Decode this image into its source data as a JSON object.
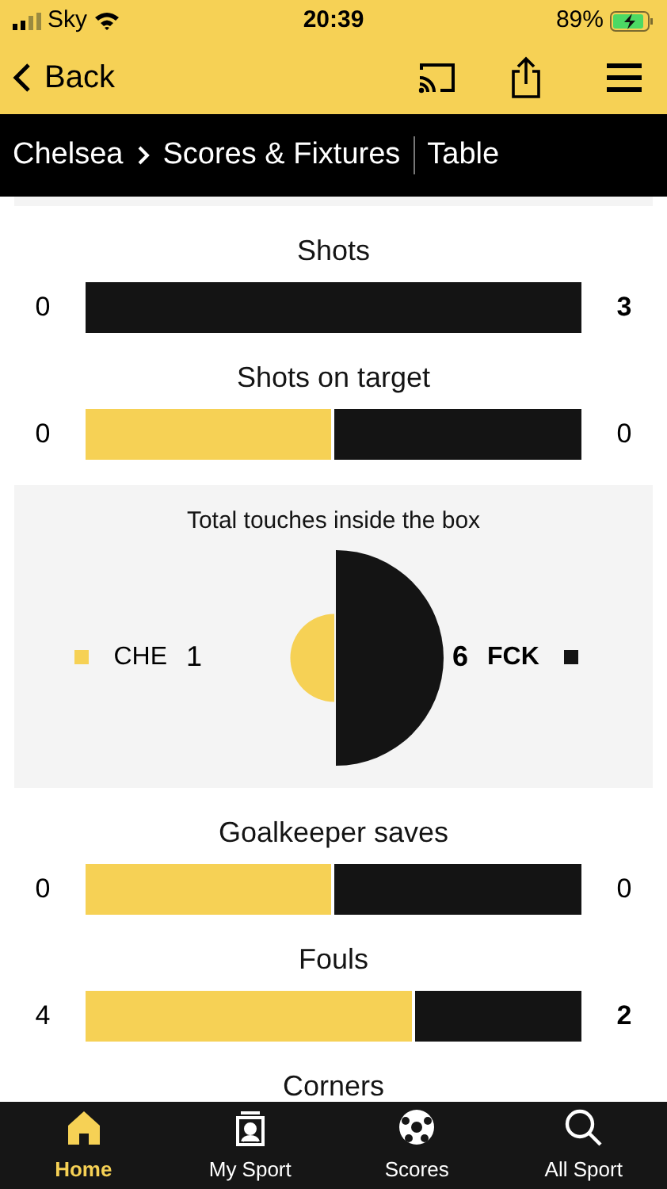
{
  "status_bar": {
    "carrier": "Sky",
    "time": "20:39",
    "battery": "89%"
  },
  "nav": {
    "back": "Back"
  },
  "breadcrumb": {
    "items": [
      "Chelsea",
      "Scores & Fixtures"
    ],
    "link": "Table"
  },
  "stats": [
    {
      "kind": "bar",
      "title": "Shots",
      "home": "0",
      "away": "3",
      "home_bold": false,
      "away_bold": true,
      "level": 0
    },
    {
      "kind": "bar",
      "title": "Shots on target",
      "home": "0",
      "away": "0",
      "home_bold": false,
      "away_bold": false,
      "level": 0.5
    },
    {
      "kind": "circles",
      "title": "Total touches inside the box",
      "home_label": "CHE",
      "home": "1",
      "away": "6",
      "away_label": "FCK"
    },
    {
      "kind": "bar",
      "title": "Goalkeeper saves",
      "home": "0",
      "away": "0",
      "home_bold": false,
      "away_bold": false,
      "level": 0.5
    },
    {
      "kind": "bar",
      "title": "Fouls",
      "home": "4",
      "away": "2",
      "home_bold": false,
      "away_bold": true,
      "level": 0.665
    },
    {
      "kind": "title",
      "title": "Corners"
    }
  ],
  "tabs": [
    {
      "label": "Home",
      "selected": true
    },
    {
      "label": "My Sport",
      "selected": false
    },
    {
      "label": "Scores",
      "selected": false
    },
    {
      "label": "All Sport",
      "selected": false
    }
  ]
}
